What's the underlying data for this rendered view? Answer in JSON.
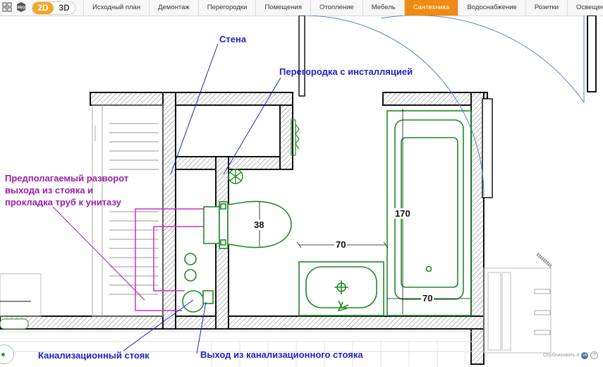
{
  "toolbar": {
    "icons": [
      "layout-icon",
      "pro-icon"
    ],
    "pro_badge": "PRO",
    "view_2d": "2D",
    "view_3d": "3D",
    "tabs": [
      {
        "label": "Исходный план",
        "active": false
      },
      {
        "label": "Демонтаж",
        "active": false
      },
      {
        "label": "Перегородки",
        "active": false
      },
      {
        "label": "Помещения",
        "active": false
      },
      {
        "label": "Отопление",
        "active": false
      },
      {
        "label": "Мебель",
        "active": false
      },
      {
        "label": "Сантехника",
        "active": true
      },
      {
        "label": "Водоснабжение",
        "active": false
      },
      {
        "label": "Розетки",
        "active": false
      },
      {
        "label": "Освещение",
        "active": false
      }
    ],
    "accent_color": "#f08a12"
  },
  "plan": {
    "annotations": {
      "wall": "Стена",
      "partition": "Перегородка с инсталляцией",
      "riser": "Канализационный стояк",
      "riser_outlet": "Выход из канализационного стояка",
      "proposed_line1": "Предполагаемый разворот",
      "proposed_line2": "выхода из стояка и",
      "proposed_line3": "прокладка труб к унитазу"
    },
    "dimensions": {
      "toilet": "38",
      "gap": "70",
      "bath_length": "170",
      "bath_width": "70"
    },
    "colors": {
      "fixture": "#1f8a26",
      "label_blue": "#1e22c8",
      "label_purple": "#9b1fa8",
      "pipe": "#d02fc8"
    }
  },
  "footer": {
    "publish_label": "Опубликовать в",
    "vk_icon_label": "vk",
    "help_label": "?"
  }
}
